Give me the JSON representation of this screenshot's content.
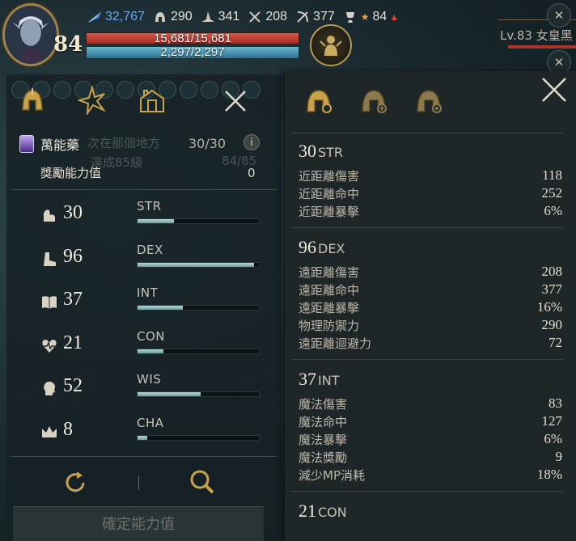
{
  "hud": {
    "level": "84",
    "stats": {
      "currency": "32,767",
      "helmet": "290",
      "hat": "341",
      "swords": "208",
      "bows": "377",
      "trophy_rank": "84"
    },
    "hp": "15,681/15,681",
    "mp": "2,297/2,297",
    "hp_fraction": 1.0,
    "mp_fraction": 1.0,
    "target_name": "Lv.83 女皇黑"
  },
  "left": {
    "elixir": {
      "name": "萬能藥",
      "count": "30/30",
      "ghost_text": "次在那個地方",
      "ghost_sub": "達成85級",
      "ghost_count": "84/85"
    },
    "bonus_label": "獎勵能力值",
    "bonus_value": "0",
    "attributes": [
      {
        "name": "STR",
        "value": "30",
        "icon": "arm-icon",
        "fill": 0.3
      },
      {
        "name": "DEX",
        "value": "96",
        "icon": "boot-icon",
        "fill": 0.96
      },
      {
        "name": "INT",
        "value": "37",
        "icon": "book-icon",
        "fill": 0.37
      },
      {
        "name": "CON",
        "value": "21",
        "icon": "heart-icon",
        "fill": 0.21
      },
      {
        "name": "WIS",
        "value": "52",
        "icon": "head-icon",
        "fill": 0.52
      },
      {
        "name": "CHA",
        "value": "8",
        "icon": "crown-icon",
        "fill": 0.08
      }
    ],
    "confirm_label": "確定能力值"
  },
  "right": {
    "sections": [
      {
        "value": "30",
        "abbr": "STR",
        "lines": [
          {
            "label": "近距離傷害",
            "value": "118"
          },
          {
            "label": "近距離命中",
            "value": "252"
          },
          {
            "label": "近距離暴擊",
            "value": "6%"
          }
        ]
      },
      {
        "value": "96",
        "abbr": "DEX",
        "lines": [
          {
            "label": "遠距離傷害",
            "value": "208"
          },
          {
            "label": "遠距離命中",
            "value": "377"
          },
          {
            "label": "遠距離暴擊",
            "value": "16%"
          },
          {
            "label": "物理防禦力",
            "value": "290"
          },
          {
            "label": "遠距離迴避力",
            "value": "72"
          }
        ]
      },
      {
        "value": "37",
        "abbr": "INT",
        "lines": [
          {
            "label": "魔法傷害",
            "value": "83"
          },
          {
            "label": "魔法命中",
            "value": "127"
          },
          {
            "label": "魔法暴擊",
            "value": "6%"
          },
          {
            "label": "魔法獎勵",
            "value": "9"
          },
          {
            "label": "減少MP消耗",
            "value": "18%"
          }
        ]
      },
      {
        "value": "21",
        "abbr": "CON",
        "lines": []
      }
    ]
  },
  "colors": {
    "hp": "#c0392b",
    "mp": "#4a9bb5",
    "accent_gold": "#b59a54"
  }
}
